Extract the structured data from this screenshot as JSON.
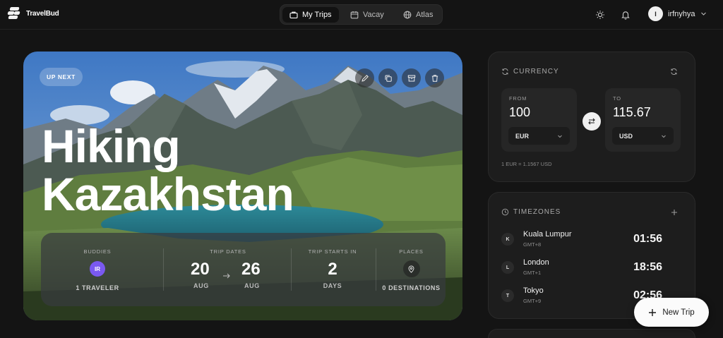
{
  "app": {
    "logo_text": "TravelBud"
  },
  "nav": [
    {
      "label": "My Trips",
      "icon": "briefcase-icon",
      "active": true
    },
    {
      "label": "Vacay",
      "icon": "calendar-icon",
      "active": false
    },
    {
      "label": "Atlas",
      "icon": "globe-icon",
      "active": false
    }
  ],
  "user": {
    "initial": "I",
    "name": "irfnyhya"
  },
  "trip": {
    "badge": "UP NEXT",
    "title_line1": "Hiking",
    "title_line2": "Kazakhstan",
    "buddies": {
      "label": "BUDDIES",
      "initials": "IR",
      "sub": "1 TRAVELER"
    },
    "dates": {
      "label": "TRIP DATES",
      "start_day": "20",
      "start_month": "AUG",
      "end_day": "26",
      "end_month": "AUG"
    },
    "starts_in": {
      "label": "TRIP STARTS IN",
      "value": "2",
      "unit": "DAYS"
    },
    "places": {
      "label": "PLACES",
      "sub": "0 DESTINATIONS"
    }
  },
  "currency": {
    "title": "CURRENCY",
    "from_label": "FROM",
    "from_value": "100",
    "from_currency": "EUR",
    "to_label": "TO",
    "to_value": "115.67",
    "to_currency": "USD",
    "rate": "1 EUR = 1.1567 USD"
  },
  "timezones": {
    "title": "TIMEZONES",
    "items": [
      {
        "initial": "K",
        "city": "Kuala Lumpur",
        "gmt": "GMT+8",
        "time": "01:56"
      },
      {
        "initial": "L",
        "city": "London",
        "gmt": "GMT+1",
        "time": "18:56"
      },
      {
        "initial": "T",
        "city": "Tokyo",
        "gmt": "GMT+9",
        "time": "02:56"
      }
    ]
  },
  "fab": {
    "label": "New Trip"
  },
  "colors": {
    "accent_buddy": "#7a59f0",
    "background": "#141414",
    "card": "#1d1d1d"
  }
}
